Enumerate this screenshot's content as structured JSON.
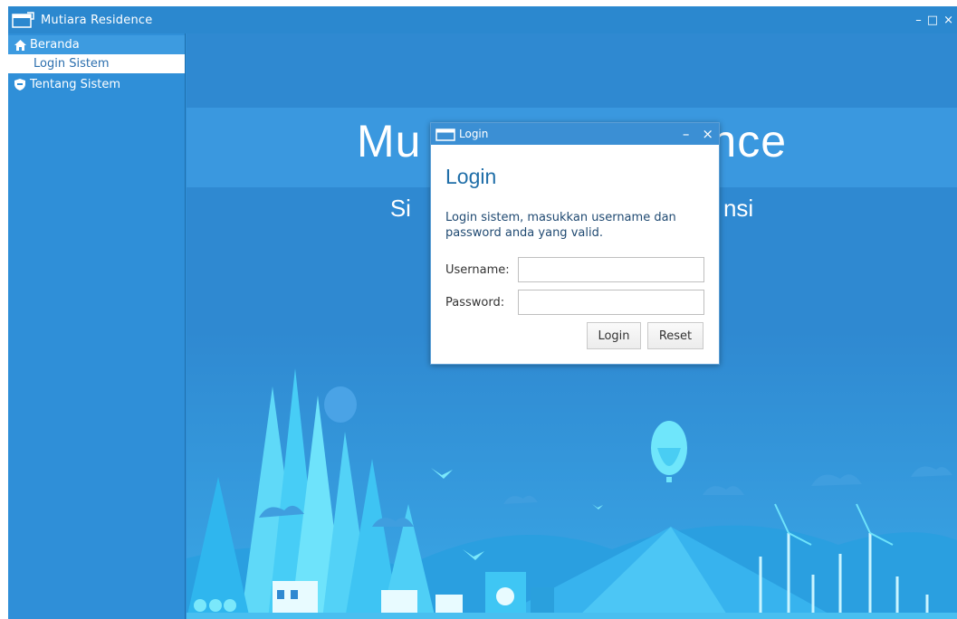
{
  "window": {
    "title": "Mutiara Residence",
    "controls": {
      "minimize": "–",
      "maximize": "□",
      "close": "×"
    }
  },
  "sidebar": {
    "items": [
      {
        "label": "Beranda",
        "icon": "home-icon"
      },
      {
        "label": "Login Sistem",
        "icon": ""
      },
      {
        "label": "Tentang Sistem",
        "icon": "shield-icon"
      }
    ]
  },
  "hero": {
    "title_left": "Mu",
    "title_right": "nce",
    "subtitle_left": "Si",
    "subtitle_right": "nsi"
  },
  "login_dialog": {
    "title": "Login",
    "controls": {
      "minimize": "–",
      "close": "×"
    },
    "heading": "Login",
    "description": "Login sistem, masukkan username dan password anda yang valid.",
    "username_label": "Username:",
    "username_value": "",
    "password_label": "Password:",
    "password_value": "",
    "login_button": "Login",
    "reset_button": "Reset"
  },
  "colors": {
    "window_blue": "#2f8fd8",
    "titlebar_blue": "#2b88cf",
    "hero_band": "#3a98df",
    "scene_cyan": "#4fd0f5",
    "dialog_heading": "#1f6ea8"
  }
}
